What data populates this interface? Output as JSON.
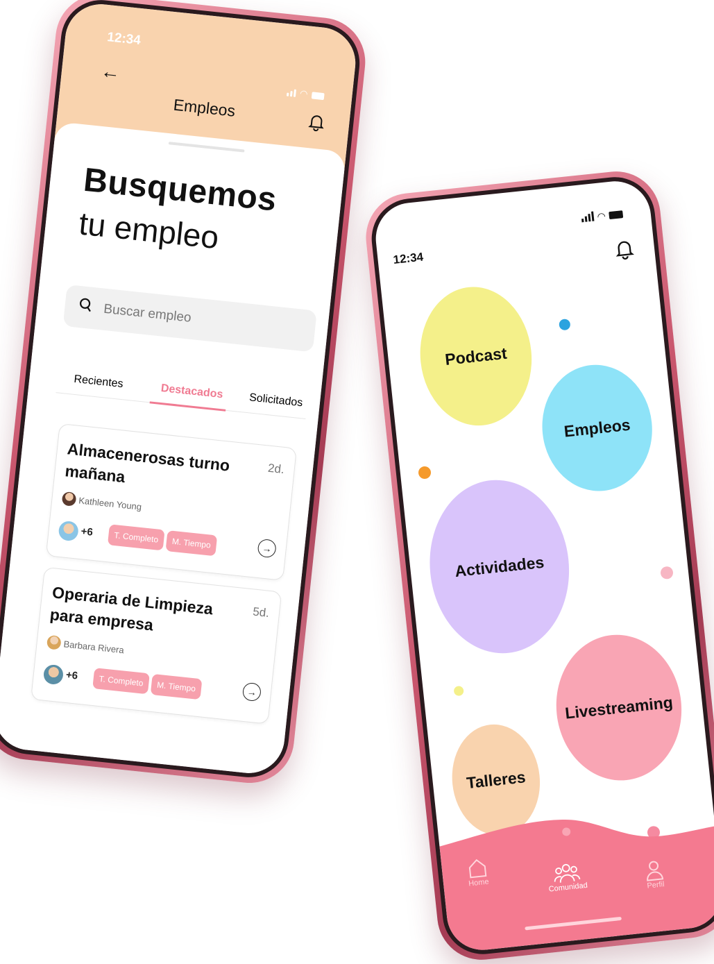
{
  "jobs_screen": {
    "time": "12:34",
    "header_title": "Empleos",
    "headline_bold": "Busquemos",
    "headline_light": "tu empleo",
    "search_placeholder": "Buscar empleo",
    "tabs": [
      {
        "label": "Recientes",
        "active": false
      },
      {
        "label": "Destacados",
        "active": true
      },
      {
        "label": "Solicitados",
        "active": false
      }
    ],
    "cards": [
      {
        "title_line1": "Almacenerosas turno",
        "title_line2": "mañana",
        "days": "2d.",
        "author": "Kathleen Young",
        "applicants_more": "+6",
        "chips": [
          "T. Completo",
          "M. Tiempo"
        ]
      },
      {
        "title_line1": "Operaria de Limpieza",
        "title_line2": "para empresa",
        "days": "5d.",
        "author": "Barbara Rivera",
        "applicants_more": "+6",
        "chips": [
          "T. Completo",
          "M. Tiempo"
        ]
      }
    ],
    "colors": {
      "header": "#f9d3ae",
      "accent": "#f07b92",
      "chip": "#f7a0ad"
    }
  },
  "community_screen": {
    "time": "12:34",
    "bubbles": [
      {
        "label": "Podcast",
        "color": "#f4f08a"
      },
      {
        "label": "Empleos",
        "color": "#8ee3f8"
      },
      {
        "label": "Actividades",
        "color": "#d9c4fb"
      },
      {
        "label": "Livestreaming",
        "color": "#f9a5b4"
      },
      {
        "label": "Talleres",
        "color": "#f9d3ae"
      }
    ],
    "nav": [
      {
        "label": "Home",
        "icon": "home-icon",
        "active": false
      },
      {
        "label": "Comunidad",
        "icon": "community-icon",
        "active": true
      },
      {
        "label": "Perfil",
        "icon": "profile-icon",
        "active": false
      }
    ],
    "colors": {
      "navbar": "#f47a90"
    }
  }
}
